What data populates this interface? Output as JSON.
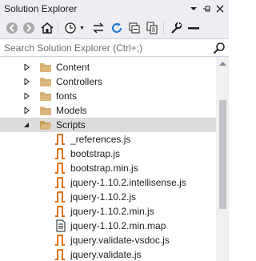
{
  "window": {
    "title": "Solution Explorer"
  },
  "toolbar": {
    "buttons": [
      {
        "icon": "back-arrow-icon"
      },
      {
        "icon": "forward-arrow-icon"
      },
      {
        "icon": "home-icon"
      },
      {
        "icon": "history-clock-icon"
      },
      {
        "icon": "sync-arrows-icon"
      },
      {
        "icon": "refresh-icon"
      },
      {
        "icon": "collapse-all-icon"
      },
      {
        "icon": "show-all-files-icon"
      },
      {
        "icon": "properties-wrench-icon"
      },
      {
        "icon": "preview-minus-icon"
      }
    ]
  },
  "search": {
    "placeholder": "Search Solution Explorer (Ctrl+;)"
  },
  "tree": {
    "items": [
      {
        "label": "Content",
        "kind": "folder",
        "expanded": false
      },
      {
        "label": "Controllers",
        "kind": "folder",
        "expanded": false
      },
      {
        "label": "fonts",
        "kind": "folder",
        "expanded": false
      },
      {
        "label": "Models",
        "kind": "folder",
        "expanded": false
      },
      {
        "label": "Scripts",
        "kind": "folder",
        "expanded": true,
        "selected": true
      },
      {
        "label": "_references.js",
        "kind": "js"
      },
      {
        "label": "bootstrap.js",
        "kind": "js"
      },
      {
        "label": "bootstrap.min.js",
        "kind": "js"
      },
      {
        "label": "jquery-1.10.2.intellisense.js",
        "kind": "js"
      },
      {
        "label": "jquery-1.10.2.js",
        "kind": "js"
      },
      {
        "label": "jquery-1.10.2.min.js",
        "kind": "js"
      },
      {
        "label": "jquery-1.10.2.min.map",
        "kind": "map"
      },
      {
        "label": "jquery.validate-vsdoc.js",
        "kind": "js"
      },
      {
        "label": "jquery.validate.js",
        "kind": "js"
      }
    ]
  },
  "colors": {
    "chrome": "#eeeef2",
    "folder": "#dcb67a",
    "js": "#e0711c",
    "selected_row": "#dcdcdc",
    "scroll_thumb": "#c2c3c9"
  }
}
